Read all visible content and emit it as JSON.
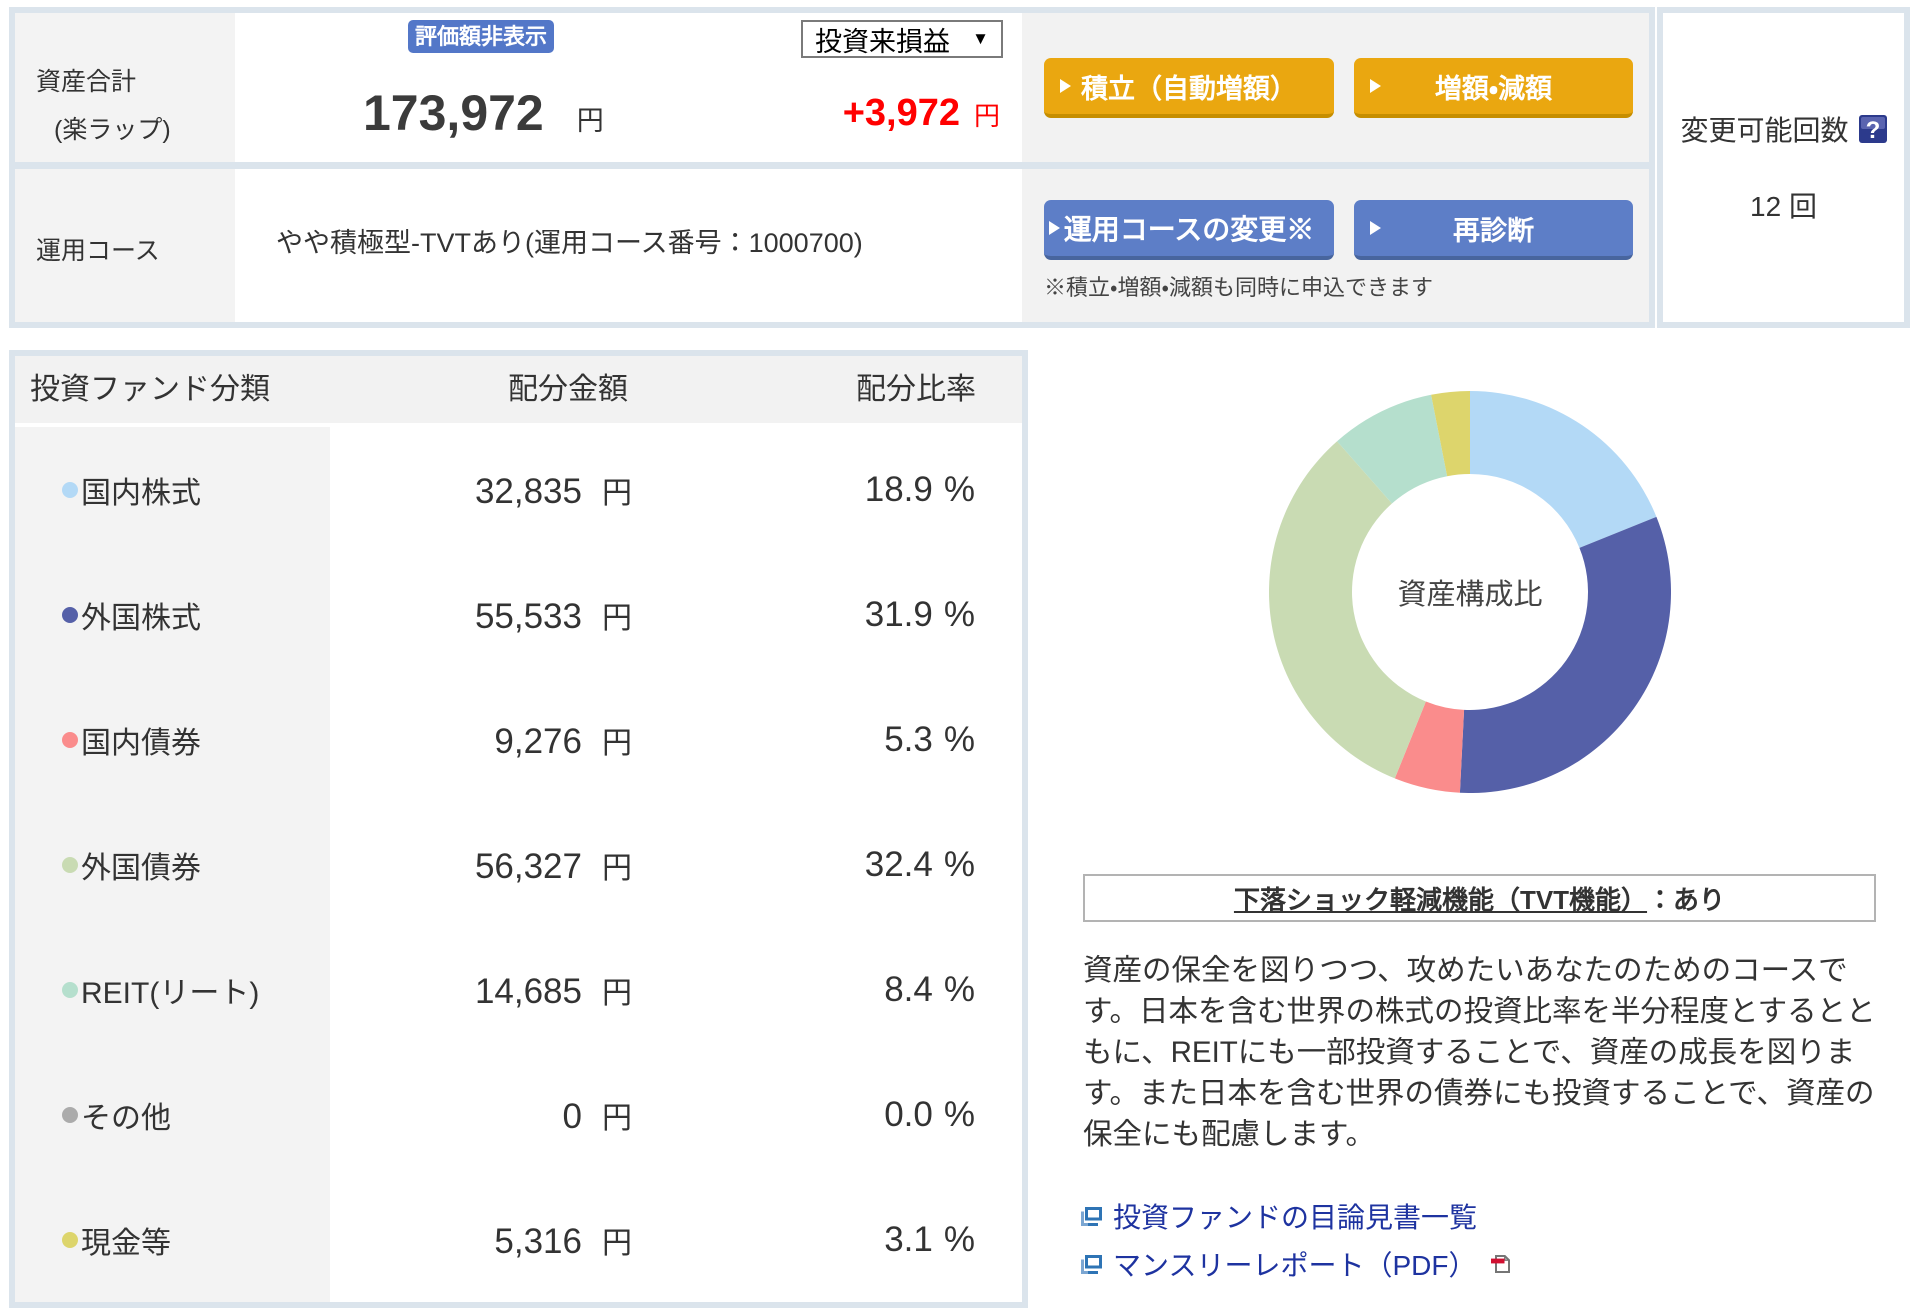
{
  "summary": {
    "total_label_line1": "資産合計",
    "total_label_line2": "(楽ラップ)",
    "hide_value_button": "評価額非表示",
    "total_amount": "173,972",
    "total_unit": "円",
    "pl_select_value": "投資来損益",
    "pl_amount": "+3,972",
    "pl_unit": "円",
    "course_label": "運用コース",
    "course_name": "やや積極型-TVTあり(運用コース番号：1000700)",
    "buttons": {
      "tsumitate": "積立（自動増額）",
      "zougaku": "増額・減額",
      "course_change": "運用コースの変更※",
      "rediagnosis": "再診断"
    },
    "note": "※積立・増額・減額も同時に申込できます"
  },
  "change_count": {
    "label": "変更可能回数",
    "help_icon": "question-mark",
    "value": "12 回"
  },
  "allocation_table": {
    "headers": {
      "category": "投資ファンド分類",
      "amount": "配分金額",
      "ratio": "配分比率"
    },
    "amount_unit": "円",
    "ratio_unit": "%",
    "rows": [
      {
        "label": "国内株式",
        "amount": "32,835",
        "percent": "18.9",
        "color": "#b3d9f6"
      },
      {
        "label": "外国株式",
        "amount": "55,533",
        "percent": "31.9",
        "color": "#5560a8"
      },
      {
        "label": "国内債券",
        "amount": "9,276",
        "percent": "5.3",
        "color": "#fa8c8c"
      },
      {
        "label": "外国債券",
        "amount": "56,327",
        "percent": "32.4",
        "color": "#c9dbb3"
      },
      {
        "label": "REIT(リート)",
        "amount": "14,685",
        "percent": "8.4",
        "color": "#b5dfcd"
      },
      {
        "label": "その他",
        "amount": "0",
        "percent": "0.0",
        "color": "#ababab"
      },
      {
        "label": "現金等",
        "amount": "5,316",
        "percent": "3.1",
        "color": "#ddd56c"
      }
    ]
  },
  "chart_data": {
    "type": "pie",
    "title": "資産構成比",
    "categories": [
      "国内株式",
      "外国株式",
      "国内債券",
      "外国債券",
      "REIT(リート)",
      "その他",
      "現金等"
    ],
    "values": [
      18.9,
      31.9,
      5.3,
      32.4,
      8.4,
      0.0,
      3.1
    ],
    "colors": [
      "#b3d9f6",
      "#5560a8",
      "#fa8c8c",
      "#c9dbb3",
      "#b5dfcd",
      "#ababab",
      "#ddd56c"
    ],
    "center_label": "資産構成比",
    "donut_outer_radius": 201,
    "donut_inner_radius": 118,
    "start_angle_deg": -90,
    "clockwise": true,
    "legend_position": "none"
  },
  "tvt": {
    "title_link": "下落ショック軽減機能（TVT機能）",
    "title_suffix": "：あり"
  },
  "course_description_lines": [
    "資産の保全を図りつつ、攻めたいあなたのためのコースで",
    "す。日本を含む世界の株式の投資比率を半分程度とするとと",
    "もに、REITにも一部投資することで、資産の成長を図りま",
    "す。また日本を含む世界の債券にも投資することで、資産の",
    "保全にも配慮します。"
  ],
  "links": {
    "prospectus": "投資ファンドの目論見書一覧",
    "monthly_report": "マンスリーレポート（PDF）"
  }
}
